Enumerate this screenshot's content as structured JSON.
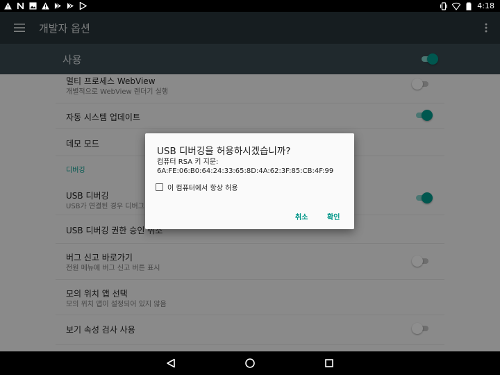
{
  "status_bar": {
    "time": "4:18",
    "left_icons": [
      "warning-icon",
      "n-icon",
      "image-icon",
      "warning-icon",
      "play-store-icon",
      "play-store-icon",
      "play-icon"
    ],
    "right_icons": [
      "vibrate-icon",
      "wifi-icon",
      "battery-icon"
    ]
  },
  "app_bar": {
    "title": "개발자 옵션",
    "background": "#263238"
  },
  "master": {
    "label": "사용",
    "enabled": true
  },
  "settings": [
    {
      "title": "멀티 프로세스 WebView",
      "subtitle": "개별적으로 WebView 렌더기 실행",
      "switch": "off"
    },
    {
      "title": "자동 시스템 업데이트",
      "subtitle": "",
      "switch": "on"
    },
    {
      "title": "데모 모드",
      "subtitle": "",
      "switch": null
    },
    {
      "category": "디버깅"
    },
    {
      "title": "USB 디버깅",
      "subtitle": "USB가 연결된 경우 디버그 모드",
      "switch": "on"
    },
    {
      "title": "USB 디버깅 권한 승인 취소",
      "subtitle": "",
      "switch": null
    },
    {
      "title": "버그 신고 바로가기",
      "subtitle": "전원 메뉴에 버그 신고 버튼 표시",
      "switch": "off"
    },
    {
      "title": "모의 위치 앱 선택",
      "subtitle": "모의 위치 앱이 설정되어 있지 않음",
      "switch": null
    },
    {
      "title": "보기 속성 검사 사용",
      "subtitle": "",
      "switch": "off"
    }
  ],
  "dialog": {
    "title": "USB 디버깅을 허용하시겠습니까?",
    "message_line1": "컴퓨터 RSA 키 지문:",
    "message_line2": "6A:FE:06:B0:64:24:33:65:8D:4A:62:3F:85:CB:4F:99",
    "checkbox_label": "이 컴퓨터에서 항상 허용",
    "checkbox_checked": false,
    "cancel_label": "취소",
    "ok_label": "확인"
  },
  "colors": {
    "accent": "#009688",
    "content_bg": "#eeeeee"
  }
}
